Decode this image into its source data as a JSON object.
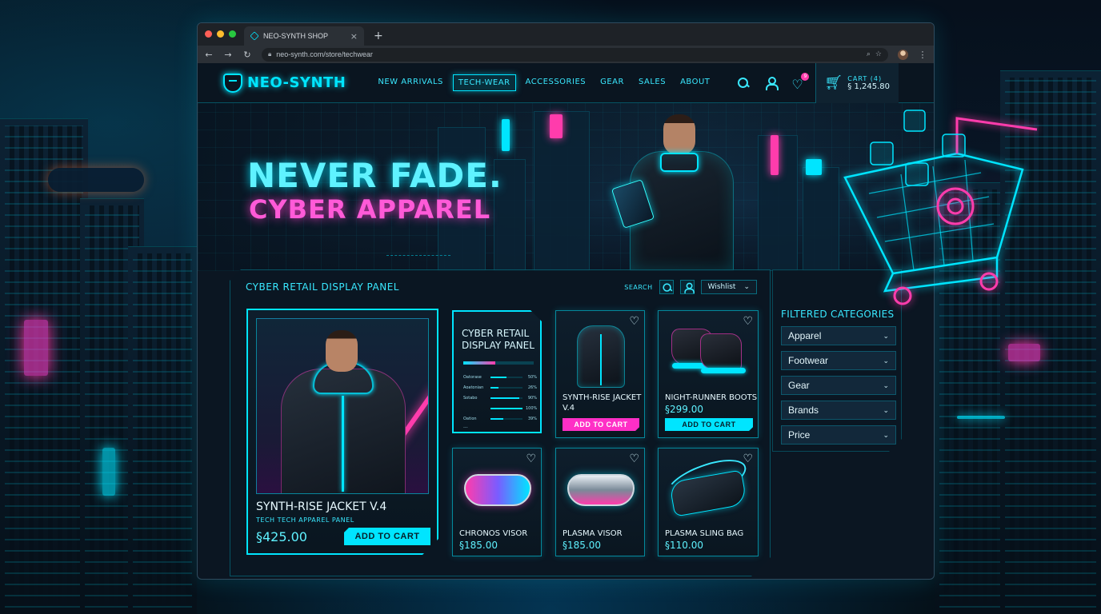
{
  "browser": {
    "tab_title": "NEO-SYNTH SHOP",
    "tab_close": "×",
    "new_tab": "+",
    "url": "neo-synth.com/store/techwear"
  },
  "header": {
    "logo_text": "NEO-SYNTH",
    "nav": [
      "NEW ARRIVALS",
      "TECH-WEAR",
      "ACCESSORIES",
      "GEAR",
      "SALES",
      "ABOUT"
    ],
    "active_nav": "TECH-WEAR",
    "wishlist_badge": "9",
    "cart_label": "CART (4)",
    "cart_total": "§ 1,245.80"
  },
  "hero": {
    "line1": "NEVER FADE.",
    "line2": "CYBER APPAREL"
  },
  "panel": {
    "title": "CYBER RETAIL DISPLAY PANEL",
    "search_label": "SEARCH",
    "wishlist_select": "Wishlist"
  },
  "featured": {
    "name": "SYNTH-RISE JACKET V.4",
    "subtitle": "TECH TECH APPAREL PANEL",
    "price": "§425.00",
    "button": "ADD TO CART"
  },
  "info_card": {
    "title": "CYBER RETAIL DISPLAY PANEL",
    "main_progress": 0.45,
    "rows": [
      {
        "label": "Oatorase",
        "pct": "50%",
        "value": 0.5
      },
      {
        "label": "Aoatonian",
        "pct": "26%",
        "value": 0.26
      },
      {
        "label": "Sotabo",
        "pct": "90%",
        "value": 0.9
      },
      {
        "label": "",
        "pct": "100%",
        "value": 1.0
      },
      {
        "label": "Oation",
        "pct": "39%",
        "value": 0.39
      }
    ],
    "footer": "..."
  },
  "products": [
    {
      "name": "SYNTH-RISE JACKET V.4",
      "price": "",
      "button": "ADD TO CART",
      "button_style": "pink"
    },
    {
      "name": "NIGHT-RUNNER BOOTS",
      "price": "§299.00",
      "button": "ADD TO CART",
      "button_style": "cyan"
    },
    {
      "name": "CHRONOS VISOR",
      "price": "§185.00"
    },
    {
      "name": "PLASMA VISOR",
      "price": "§185.00"
    },
    {
      "name": "PLASMA SLING BAG",
      "price": "§110.00"
    }
  ],
  "sidebar": {
    "title": "FILTERED CATEGORIES",
    "items": [
      "Apparel",
      "Footwear",
      "Gear",
      "Brands",
      "Price"
    ]
  },
  "icons": {
    "heart": "♡",
    "chevron": "⌄"
  },
  "colors": {
    "accent_cyan": "#00e5ff",
    "accent_pink": "#ff3cac",
    "background": "#0b1622"
  }
}
